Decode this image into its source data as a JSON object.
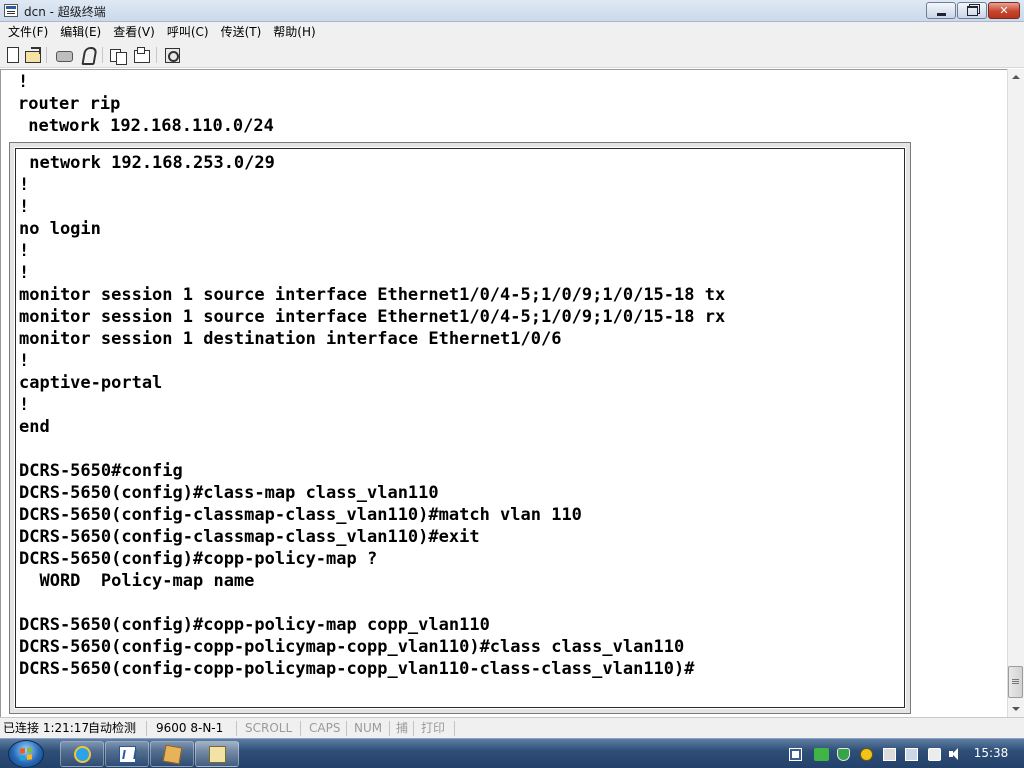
{
  "window": {
    "title": "dcn - 超级终端",
    "caption_buttons": {
      "minimize": "minimize-icon",
      "maximize": "maximize-icon",
      "close_label": "✕"
    }
  },
  "menu": {
    "items": [
      {
        "label": "文件(F)"
      },
      {
        "label": "编辑(E)"
      },
      {
        "label": "查看(V)"
      },
      {
        "label": "呼叫(C)"
      },
      {
        "label": "传送(T)"
      },
      {
        "label": "帮助(H)"
      }
    ]
  },
  "toolbar": {
    "icons": [
      "new-document-icon",
      "open-folder-icon",
      "phone-connect-icon",
      "hang-up-icon",
      "send-file-icon",
      "receive-file-icon",
      "properties-icon"
    ]
  },
  "terminal": {
    "background_lines": [
      "!",
      "router rip",
      " network 192.168.110.0/24"
    ],
    "panel_lines": [
      " network 192.168.253.0/29",
      "!",
      "!",
      "no login",
      "!",
      "!",
      "monitor session 1 source interface Ethernet1/0/4-5;1/0/9;1/0/15-18 tx",
      "monitor session 1 source interface Ethernet1/0/4-5;1/0/9;1/0/15-18 rx",
      "monitor session 1 destination interface Ethernet1/0/6",
      "!",
      "captive-portal",
      "!",
      "end",
      "",
      "DCRS-5650#config",
      "DCRS-5650(config)#class-map class_vlan110",
      "DCRS-5650(config-classmap-class_vlan110)#match vlan 110",
      "DCRS-5650(config-classmap-class_vlan110)#exit",
      "DCRS-5650(config)#copp-policy-map ?",
      "  WORD  Policy-map name",
      "",
      "DCRS-5650(config)#copp-policy-map copp_vlan110",
      "DCRS-5650(config-copp-policymap-copp_vlan110)#class class_vlan110",
      "DCRS-5650(config-copp-policymap-copp_vlan110-class-class_vlan110)#"
    ]
  },
  "status": {
    "connection": "已连接 1:21:17",
    "detect": "自动检测",
    "settings": "9600 8-N-1",
    "scroll": "SCROLL",
    "caps": "CAPS",
    "num": "NUM",
    "capture": "捕",
    "print": "打印"
  },
  "taskbar": {
    "clock": "15:38",
    "apps": [
      "internet-explorer-icon",
      "word-icon",
      "package-icon",
      "hyperterminal-icon"
    ],
    "tray": [
      "action-center-icon",
      "battery-icon",
      "shield-icon",
      "security-icon",
      "usb-icon",
      "network-icon",
      "notification-icon",
      "volume-icon"
    ]
  },
  "colors": {
    "terminal_text": "#000000",
    "terminal_bg": "#ffffff",
    "taskbar": "#2f4f78"
  }
}
